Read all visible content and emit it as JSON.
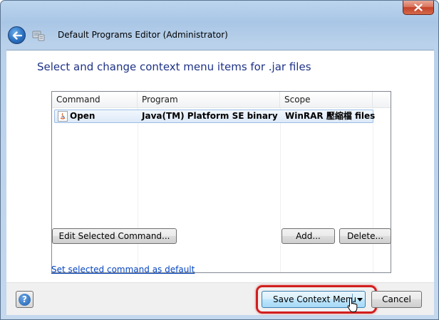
{
  "window": {
    "title": "Default Programs Editor (Administrator)"
  },
  "content": {
    "heading": "Select and change context menu items for .jar files",
    "list": {
      "columns": [
        "Command",
        "Program",
        "Scope"
      ],
      "rows": [
        {
          "command": "Open",
          "program": "Java(TM) Platform SE binary",
          "scope": "WinRAR 壓縮檔 files",
          "selected": true
        }
      ]
    },
    "buttons": {
      "edit": "Edit Selected Command...",
      "add": "Add...",
      "delete": "Delete..."
    },
    "link": "Set selected command as default"
  },
  "footer": {
    "help_icon": "?",
    "save": "Save Context Menu",
    "cancel": "Cancel"
  },
  "colors": {
    "heading": "#1e3287",
    "link": "#0645c1",
    "highlight": "#d21e1e",
    "close": "#c4412a"
  }
}
